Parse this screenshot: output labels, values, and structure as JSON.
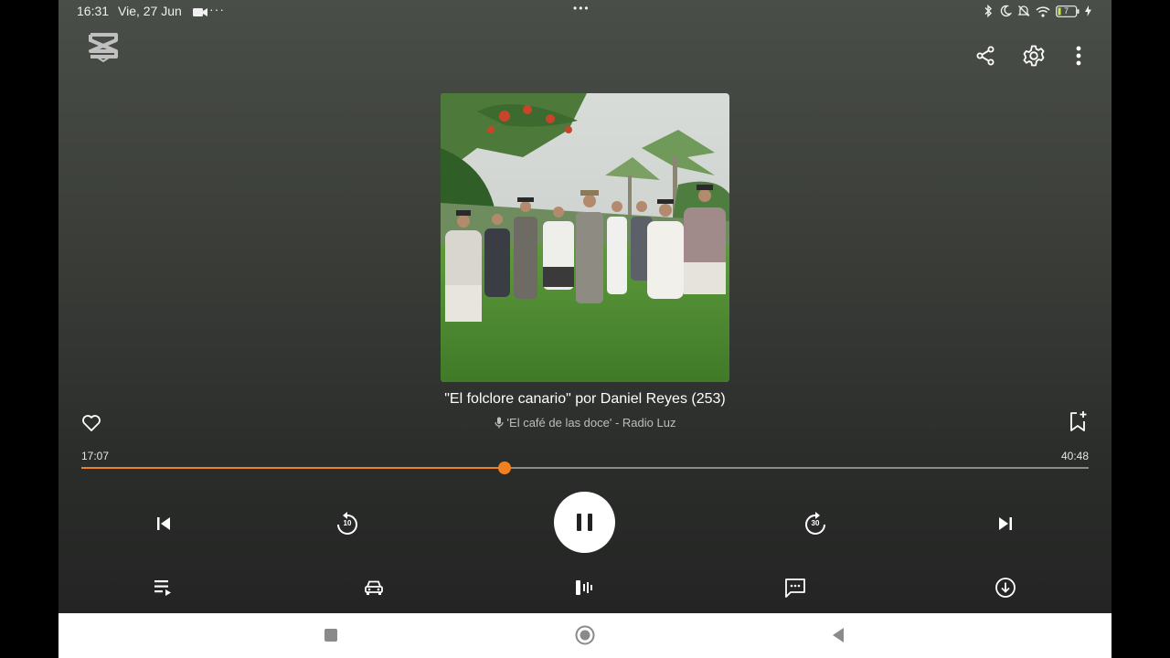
{
  "status_bar": {
    "time": "16:31",
    "date": "Vie, 27 Jun",
    "more": "···",
    "center_dots": "•••",
    "battery": "7"
  },
  "episode": {
    "title": "\"El folclore canario\" por Daniel Reyes (253)",
    "subtitle": "'El café de las doce' - Radio Luz"
  },
  "progress": {
    "elapsed": "17:07",
    "duration": "40:48",
    "fraction": 0.42
  },
  "colors": {
    "accent": "#f2801e",
    "background_top": "#4a4e48",
    "background_bottom": "#232423"
  },
  "icons": {
    "app_logo": "capcut-logo-icon",
    "share": "share-icon",
    "settings": "gear-icon",
    "menu": "more-vert-icon",
    "favorite": "heart-icon",
    "bookmark": "bookmark-add-icon",
    "skip_previous": "skip-previous-icon",
    "rewind": "replay-10-icon",
    "pause": "pause-icon",
    "forward": "forward-30-icon",
    "skip_next": "skip-next-icon",
    "queue": "playlist-icon",
    "car_mode": "car-icon",
    "audio_effects": "waveform-icon",
    "comments": "comment-icon",
    "download": "download-icon"
  },
  "controls": {
    "rewind_seconds": "10",
    "forward_seconds": "30"
  }
}
